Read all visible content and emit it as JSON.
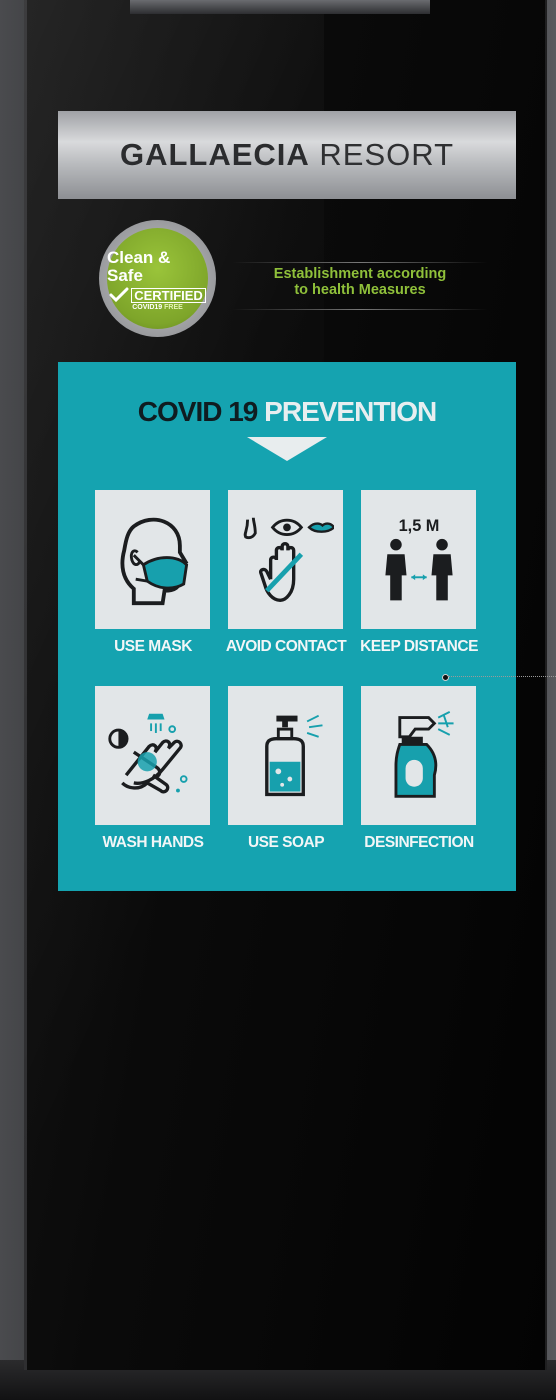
{
  "header": {
    "brand_bold": "GALLAECIA",
    "brand_light": "RESORT"
  },
  "badge": {
    "line1": "Clean & Safe",
    "line2": "CERTIFIED",
    "line3": "COVID19",
    "line3_accent": "FREE",
    "icon": "checkmark-icon"
  },
  "tagline": {
    "line1": "Establishment according",
    "line2": "to health Measures"
  },
  "panel": {
    "title_dark": "COVID 19",
    "title_light": "PREVENTION",
    "items": [
      {
        "label": "USE MASK",
        "icon": "face-mask-icon"
      },
      {
        "label": "AVOID CONTACT",
        "icon": "no-touch-face-icon"
      },
      {
        "label": "KEEP DISTANCE",
        "icon": "social-distance-icon",
        "distance_text": "1,5 M"
      },
      {
        "label": "WASH HANDS",
        "icon": "hand-wash-icon"
      },
      {
        "label": "USE SOAP",
        "icon": "soap-dispenser-icon"
      },
      {
        "label": "DESINFECTION",
        "icon": "spray-bottle-icon"
      }
    ]
  },
  "colors": {
    "panel": "#15a3b0",
    "accent_green": "#8fc03a",
    "tile": "#e2e6e8",
    "icon_teal": "#17a0ad",
    "icon_dark": "#1b1d1f"
  }
}
